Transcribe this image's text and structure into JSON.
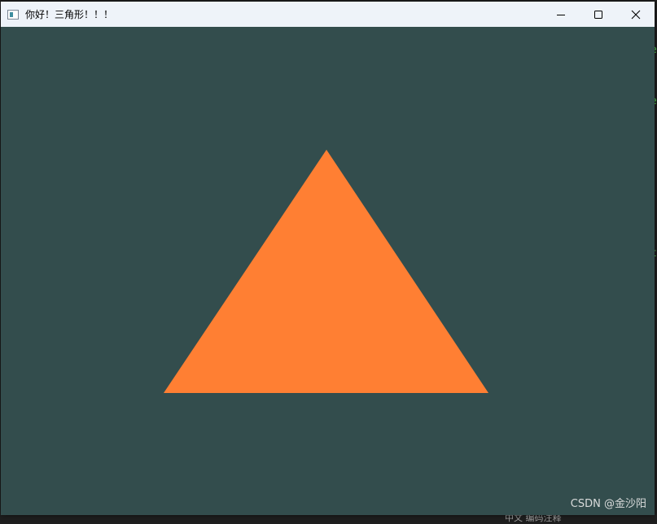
{
  "window": {
    "title": "你好！三角形！！！",
    "background_color": "#334d4d",
    "titlebar_color": "#eef3f9",
    "controls": {
      "minimize_icon": "minimize-icon",
      "maximize_icon": "maximize-icon",
      "close_icon": "close-icon"
    }
  },
  "scene": {
    "shape": "triangle",
    "fill_color": "#ff7f33"
  },
  "watermark": {
    "text": "CSDN @金沙阳"
  },
  "background_app": {
    "code_fragments": [
      "e",
      "e",
      "t"
    ],
    "bottom_strip": "中文  编码注释"
  }
}
